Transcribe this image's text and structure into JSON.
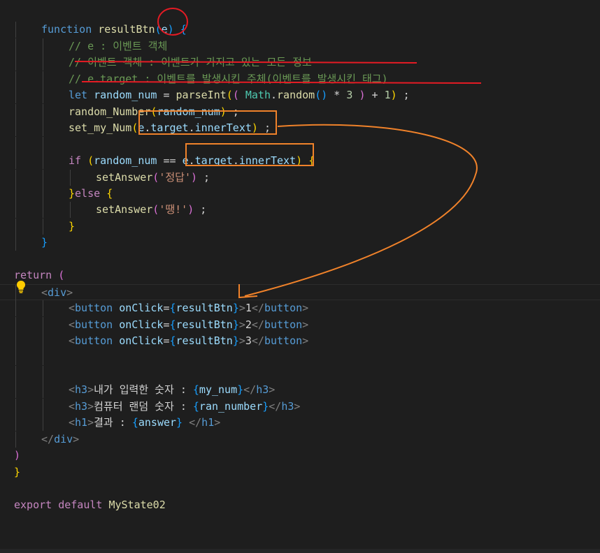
{
  "editor": {
    "language": "javascript-react",
    "theme_background": "#1e1e1e",
    "lines": [
      {
        "row": 0,
        "indent": 0,
        "tokens": []
      },
      {
        "row": 1,
        "indent": 2,
        "tokens": [
          [
            "kw",
            "function "
          ],
          [
            "fn",
            "resultBtn"
          ],
          [
            "br3",
            "("
          ],
          [
            "var",
            "e"
          ],
          [
            "br3",
            ")"
          ],
          [
            "txt",
            " "
          ],
          [
            "br3",
            "{"
          ]
        ]
      },
      {
        "row": 2,
        "indent": 3,
        "tokens": [
          [
            "cmt",
            "// e : 이벤트 객체"
          ]
        ]
      },
      {
        "row": 3,
        "indent": 3,
        "tokens": [
          [
            "cmt",
            "// 이벤트 객체 : 이벤트가 가지고 있는 모든 정보"
          ]
        ]
      },
      {
        "row": 4,
        "indent": 3,
        "tokens": [
          [
            "cmt",
            "// e.target : 이벤트를 발생시킨 주체(이벤트를 발생시킨 태그)"
          ]
        ]
      },
      {
        "row": 5,
        "indent": 3,
        "tokens": [
          [
            "kw",
            "let "
          ],
          [
            "var",
            "random_num"
          ],
          [
            "txt",
            " = "
          ],
          [
            "fn",
            "parseInt"
          ],
          [
            "br1",
            "("
          ],
          [
            "br2",
            "( "
          ],
          [
            "cls",
            "Math"
          ],
          [
            "txt",
            "."
          ],
          [
            "fn",
            "random"
          ],
          [
            "br3",
            "()"
          ],
          [
            "txt",
            " * "
          ],
          [
            "num",
            "3"
          ],
          [
            "txt",
            " "
          ],
          [
            "br2",
            ")"
          ],
          [
            "txt",
            " + "
          ],
          [
            "num",
            "1"
          ],
          [
            "br1",
            ")"
          ],
          [
            "txt",
            " ;"
          ]
        ]
      },
      {
        "row": 6,
        "indent": 3,
        "tokens": [
          [
            "fn",
            "random_Number"
          ],
          [
            "br1",
            "("
          ],
          [
            "var",
            "random_num"
          ],
          [
            "br1",
            ")"
          ],
          [
            "txt",
            " ;"
          ]
        ]
      },
      {
        "row": 7,
        "indent": 3,
        "tokens": [
          [
            "fn",
            "set_my_Num"
          ],
          [
            "br1",
            "("
          ],
          [
            "var",
            "e"
          ],
          [
            "txt",
            "."
          ],
          [
            "var",
            "target"
          ],
          [
            "txt",
            "."
          ],
          [
            "var",
            "innerText"
          ],
          [
            "br1",
            ")"
          ],
          [
            "txt",
            " ;"
          ]
        ]
      },
      {
        "row": 8,
        "indent": 3,
        "tokens": []
      },
      {
        "row": 9,
        "indent": 3,
        "tokens": [
          [
            "kw2",
            "if "
          ],
          [
            "br1",
            "("
          ],
          [
            "var",
            "random_num"
          ],
          [
            "txt",
            " == "
          ],
          [
            "var",
            "e"
          ],
          [
            "txt",
            "."
          ],
          [
            "var",
            "target"
          ],
          [
            "txt",
            "."
          ],
          [
            "var",
            "innerText"
          ],
          [
            "br1",
            ")"
          ],
          [
            "txt",
            " "
          ],
          [
            "br1",
            "{"
          ]
        ]
      },
      {
        "row": 10,
        "indent": 4,
        "tokens": [
          [
            "fn",
            "setAnswer"
          ],
          [
            "br2",
            "("
          ],
          [
            "str",
            "'정답'"
          ],
          [
            "br2",
            ")"
          ],
          [
            "txt",
            " ;"
          ]
        ]
      },
      {
        "row": 11,
        "indent": 3,
        "tokens": [
          [
            "br1",
            "}"
          ],
          [
            "kw2",
            "else "
          ],
          [
            "br1",
            "{"
          ]
        ]
      },
      {
        "row": 12,
        "indent": 4,
        "tokens": [
          [
            "fn",
            "setAnswer"
          ],
          [
            "br2",
            "("
          ],
          [
            "str",
            "'땡!'"
          ],
          [
            "br2",
            ")"
          ],
          [
            "txt",
            " ;"
          ]
        ]
      },
      {
        "row": 13,
        "indent": 3,
        "tokens": [
          [
            "br1",
            "}"
          ]
        ]
      },
      {
        "row": 14,
        "indent": 2,
        "tokens": [
          [
            "br3",
            "}"
          ]
        ]
      },
      {
        "row": 15,
        "indent": 0,
        "tokens": []
      },
      {
        "row": 16,
        "indent": 1,
        "tokens": [
          [
            "kw2",
            "return "
          ],
          [
            "br2",
            "("
          ]
        ]
      },
      {
        "row": 17,
        "indent": 2,
        "tokens": [
          [
            "tagpunct",
            "<"
          ],
          [
            "tag",
            "div"
          ],
          [
            "tagpunct",
            ">"
          ]
        ]
      },
      {
        "row": 18,
        "indent": 3,
        "tokens": [
          [
            "tagpunct",
            "<"
          ],
          [
            "tag",
            "button"
          ],
          [
            "txt",
            " "
          ],
          [
            "attr",
            "onClick"
          ],
          [
            "txt",
            "="
          ],
          [
            "br3",
            "{"
          ],
          [
            "var",
            "resultBtn"
          ],
          [
            "br3",
            "}"
          ],
          [
            "tagpunct",
            ">"
          ],
          [
            "txt",
            "1"
          ],
          [
            "tagpunct",
            "</"
          ],
          [
            "tag",
            "button"
          ],
          [
            "tagpunct",
            ">"
          ]
        ]
      },
      {
        "row": 19,
        "indent": 3,
        "tokens": [
          [
            "tagpunct",
            "<"
          ],
          [
            "tag",
            "button"
          ],
          [
            "txt",
            " "
          ],
          [
            "attr",
            "onClick"
          ],
          [
            "txt",
            "="
          ],
          [
            "br3",
            "{"
          ],
          [
            "var",
            "resultBtn"
          ],
          [
            "br3",
            "}"
          ],
          [
            "tagpunct",
            ">"
          ],
          [
            "txt",
            "2"
          ],
          [
            "tagpunct",
            "</"
          ],
          [
            "tag",
            "button"
          ],
          [
            "tagpunct",
            ">"
          ]
        ]
      },
      {
        "row": 20,
        "indent": 3,
        "tokens": [
          [
            "tagpunct",
            "<"
          ],
          [
            "tag",
            "button"
          ],
          [
            "txt",
            " "
          ],
          [
            "attr",
            "onClick"
          ],
          [
            "txt",
            "="
          ],
          [
            "br3",
            "{"
          ],
          [
            "var",
            "resultBtn"
          ],
          [
            "br3",
            "}"
          ],
          [
            "tagpunct",
            ">"
          ],
          [
            "txt",
            "3"
          ],
          [
            "tagpunct",
            "</"
          ],
          [
            "tag",
            "button"
          ],
          [
            "tagpunct",
            ">"
          ]
        ]
      },
      {
        "row": 21,
        "indent": 3,
        "tokens": []
      },
      {
        "row": 22,
        "indent": 3,
        "tokens": []
      },
      {
        "row": 23,
        "indent": 3,
        "tokens": [
          [
            "tagpunct",
            "<"
          ],
          [
            "tag",
            "h3"
          ],
          [
            "tagpunct",
            ">"
          ],
          [
            "txt",
            "내가 입력한 숫자 : "
          ],
          [
            "br3",
            "{"
          ],
          [
            "var",
            "my_num"
          ],
          [
            "br3",
            "}"
          ],
          [
            "tagpunct",
            "</"
          ],
          [
            "tag",
            "h3"
          ],
          [
            "tagpunct",
            ">"
          ]
        ]
      },
      {
        "row": 24,
        "indent": 3,
        "tokens": [
          [
            "tagpunct",
            "<"
          ],
          [
            "tag",
            "h3"
          ],
          [
            "tagpunct",
            ">"
          ],
          [
            "txt",
            "컴퓨터 랜덤 숫자 : "
          ],
          [
            "br3",
            "{"
          ],
          [
            "var",
            "ran_number"
          ],
          [
            "br3",
            "}"
          ],
          [
            "tagpunct",
            "</"
          ],
          [
            "tag",
            "h3"
          ],
          [
            "tagpunct",
            ">"
          ]
        ]
      },
      {
        "row": 25,
        "indent": 3,
        "tokens": [
          [
            "tagpunct",
            "<"
          ],
          [
            "tag",
            "h1"
          ],
          [
            "tagpunct",
            ">"
          ],
          [
            "txt",
            "결과 : "
          ],
          [
            "br3",
            "{"
          ],
          [
            "var",
            "answer"
          ],
          [
            "br3",
            "}"
          ],
          [
            "txt",
            " "
          ],
          [
            "tagpunct",
            "</"
          ],
          [
            "tag",
            "h1"
          ],
          [
            "tagpunct",
            ">"
          ]
        ]
      },
      {
        "row": 26,
        "indent": 2,
        "tokens": [
          [
            "tagpunct",
            "</"
          ],
          [
            "tag",
            "div"
          ],
          [
            "tagpunct",
            ">"
          ]
        ]
      },
      {
        "row": 27,
        "indent": 1,
        "tokens": [
          [
            "br2",
            ")"
          ]
        ]
      },
      {
        "row": 28,
        "indent": 0,
        "tokens": [
          [
            "br1",
            "}"
          ]
        ]
      },
      {
        "row": 29,
        "indent": 0,
        "tokens": []
      },
      {
        "row": 30,
        "indent": 0,
        "tokens": [
          [
            "kw2",
            "export "
          ],
          [
            "kw2",
            "default "
          ],
          [
            "fn",
            "MyState02"
          ]
        ]
      }
    ]
  },
  "annotations": {
    "circle_color": "#e51b24",
    "underline_color": "#e51b24",
    "box_color": "#f0822a",
    "arrow_color": "#f0822a"
  },
  "icons": {
    "lightbulb": "lightbulb-icon"
  },
  "colors": {
    "keyword": "#569cd6",
    "control": "#c586c0",
    "function": "#dcdcaa",
    "variable": "#9cdcfe",
    "string": "#ce9178",
    "number": "#b5cea8",
    "comment": "#6a9955"
  }
}
